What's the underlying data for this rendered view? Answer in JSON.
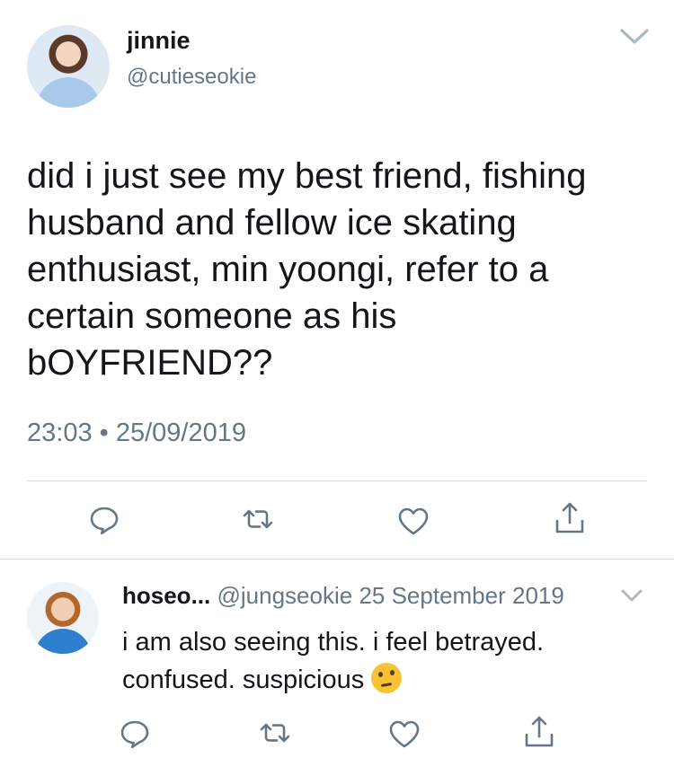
{
  "tweet": {
    "author_name": "jinnie",
    "author_handle": "@cutieseokie",
    "text": "did i just see my best friend, fishing husband and fellow ice skating enthusiast, min yoongi, refer to a certain someone as his bOYFRIEND??",
    "time": "23:03",
    "separator": "•",
    "date": "25/09/2019",
    "actions": [
      "reply-icon",
      "retweet-icon",
      "like-icon",
      "share-icon"
    ]
  },
  "reply": {
    "author_name": "hoseo...",
    "author_handle": "@jungseokie",
    "date": "25 September 2019",
    "text": "i am also seeing this. i feel betrayed. confused. suspicious",
    "emoji": "thinking-face-emoji",
    "actions": [
      "reply-icon",
      "retweet-icon",
      "like-icon",
      "share-icon"
    ]
  },
  "colors": {
    "text": "#14171a",
    "secondary": "#657786",
    "divider": "#d5dbe0",
    "icon": "#657786"
  }
}
